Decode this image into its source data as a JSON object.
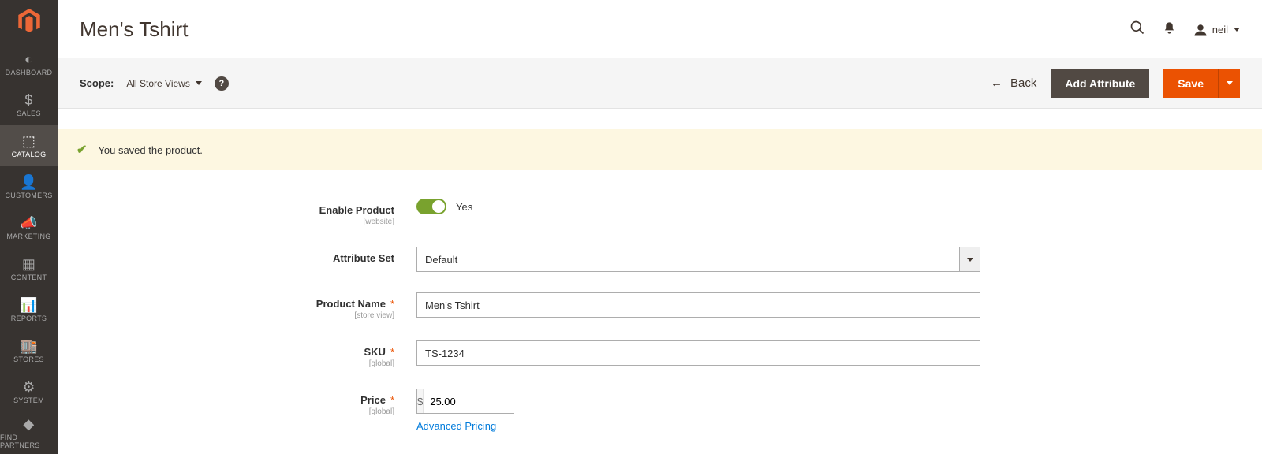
{
  "sidebar": {
    "items": [
      {
        "label": "DASHBOARD",
        "icon": "◐"
      },
      {
        "label": "SALES",
        "icon": "$"
      },
      {
        "label": "CATALOG",
        "icon": "⬚"
      },
      {
        "label": "CUSTOMERS",
        "icon": "👤"
      },
      {
        "label": "MARKETING",
        "icon": "📣"
      },
      {
        "label": "CONTENT",
        "icon": "▦"
      },
      {
        "label": "REPORTS",
        "icon": "📊"
      },
      {
        "label": "STORES",
        "icon": "🏬"
      },
      {
        "label": "SYSTEM",
        "icon": "⚙"
      },
      {
        "label": "FIND PARTNERS",
        "icon": "◆"
      }
    ],
    "active_index": 2
  },
  "header": {
    "page_title": "Men's Tshirt",
    "user_name": "neil"
  },
  "toolbar": {
    "scope_label": "Scope:",
    "scope_value": "All Store Views",
    "back_label": "Back",
    "add_attribute_label": "Add Attribute",
    "save_label": "Save"
  },
  "message": {
    "text": "You saved the product."
  },
  "form": {
    "enable_product": {
      "label": "Enable Product",
      "scope": "[website]",
      "value_text": "Yes",
      "enabled": true
    },
    "attribute_set": {
      "label": "Attribute Set",
      "value": "Default"
    },
    "product_name": {
      "label": "Product Name",
      "scope": "[store view]",
      "value": "Men's Tshirt",
      "required": true
    },
    "sku": {
      "label": "SKU",
      "scope": "[global]",
      "value": "TS-1234",
      "required": true
    },
    "price": {
      "label": "Price",
      "scope": "[global]",
      "currency": "$",
      "value": "25.00",
      "required": true,
      "advanced_link": "Advanced Pricing"
    }
  }
}
